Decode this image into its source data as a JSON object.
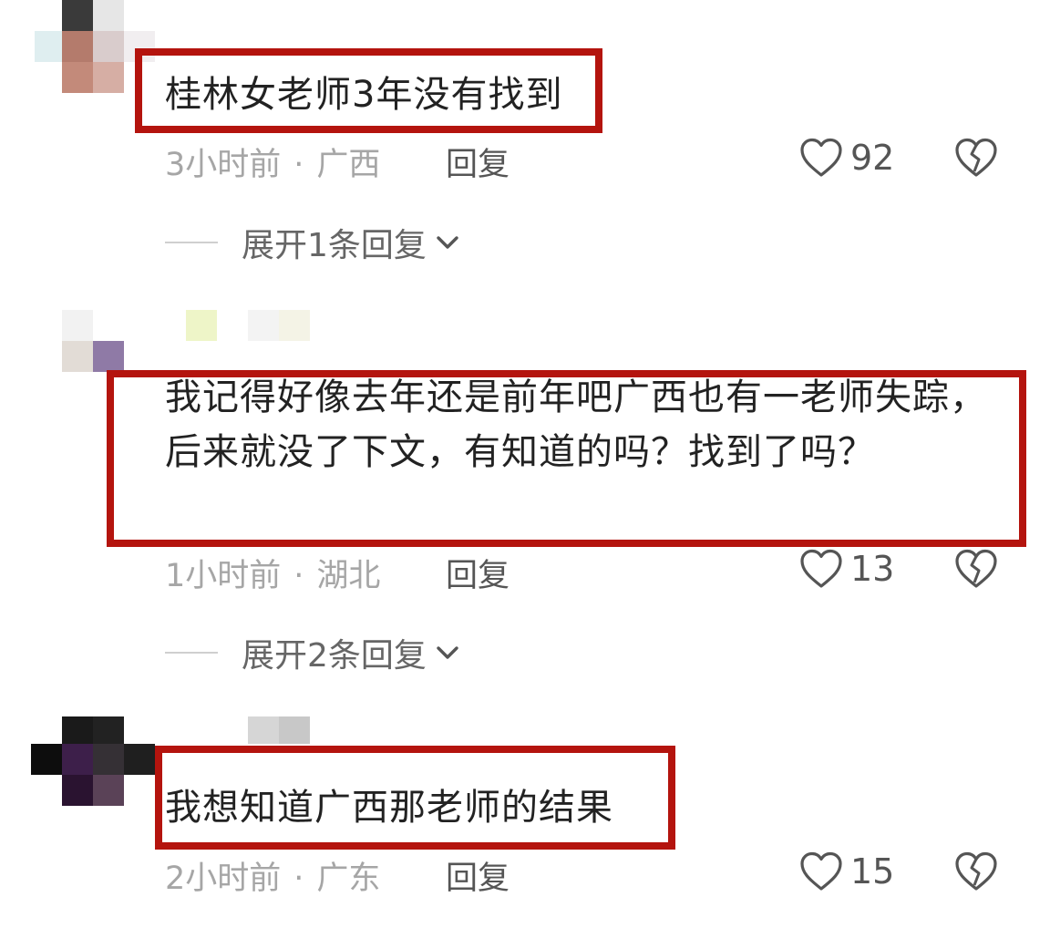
{
  "comments": [
    {
      "content": "桂林女老师3年没有找到",
      "time": "3小时前",
      "location": "广西",
      "reply_label": "回复",
      "likes": "92",
      "expand_label": "展开1条回复"
    },
    {
      "content": "我记得好像去年还是前年吧广西也有一老师失踪，后来就没了下文，有知道的吗？找到了吗？",
      "time": "1小时前",
      "location": "湖北",
      "reply_label": "回复",
      "likes": "13",
      "expand_label": "展开2条回复"
    },
    {
      "content": "我想知道广西那老师的结果",
      "time": "2小时前",
      "location": "广东",
      "reply_label": "回复",
      "likes": "15"
    }
  ],
  "meta_separator": "·",
  "colors": {
    "highlight_border": "#b4140e",
    "meta_text": "#a6a6a6"
  },
  "icons": {
    "like": "heart-outline-icon",
    "dislike": "broken-heart-icon",
    "expand": "chevron-down-icon"
  }
}
